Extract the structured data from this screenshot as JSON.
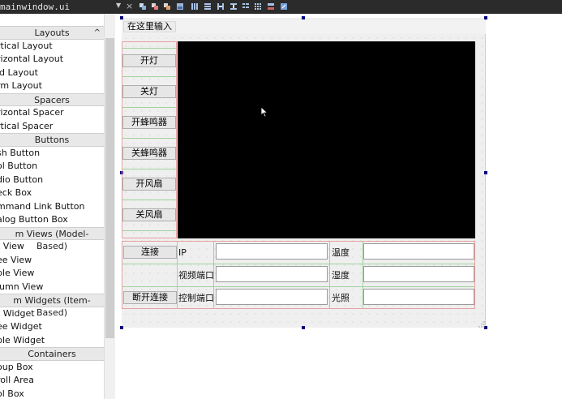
{
  "editor": {
    "file_tab": "mainwindow.ui",
    "close_glyph": "×",
    "toolbar_icons": [
      "edit-widgets-icon",
      "edit-signals-icon",
      "edit-buddies-icon",
      "edit-tab-order-icon",
      "layout-horizontal-icon",
      "layout-vertical-icon",
      "layout-h-splitter-icon",
      "layout-v-splitter-icon",
      "layout-form-icon",
      "layout-grid-icon",
      "break-layout-icon",
      "adjust-size-icon"
    ]
  },
  "widget_box": {
    "sections": [
      {
        "title": "Layouts",
        "items": [
          "rtical Layout",
          "rizontal Layout",
          "id Layout",
          "rm Layout"
        ]
      },
      {
        "title": "Spacers",
        "items": [
          "rizontal Spacer",
          "rtical Spacer"
        ]
      },
      {
        "title": "Buttons",
        "items": [
          "sh Button",
          "ol Button",
          "dio Button",
          "eck Box",
          "mmand Link Button",
          "alog Button Box"
        ]
      },
      {
        "title": "m Views (Model-Based)",
        "items": [
          "t View",
          "ee View",
          "ble View",
          "lumn View"
        ]
      },
      {
        "title": "m Widgets (Item-Based)",
        "items": [
          "t Widget",
          "ee Widget",
          "ble Widget"
        ]
      },
      {
        "title": "Containers",
        "items": [
          "oup Box",
          "roll Area",
          "ol Box"
        ]
      }
    ],
    "collapse_glyph": "^"
  },
  "form": {
    "menu_placeholder": "在这里输入",
    "buttons": {
      "light_on": "开灯",
      "light_off": "关灯",
      "buzzer_on": "开蜂鸣器",
      "buzzer_off": "关蜂鸣器",
      "fan_on": "开风扇",
      "fan_off": "关风扇",
      "connect": "连接",
      "disconnect": "断开连接"
    },
    "labels": {
      "ip": "IP",
      "video_port": "视频端口",
      "control_port": "控制端口",
      "temperature": "温度",
      "humidity": "湿度",
      "light": "光照"
    },
    "inputs": {
      "ip": "",
      "video_port": "",
      "control_port": "",
      "temperature": "",
      "humidity": "",
      "light": ""
    }
  }
}
